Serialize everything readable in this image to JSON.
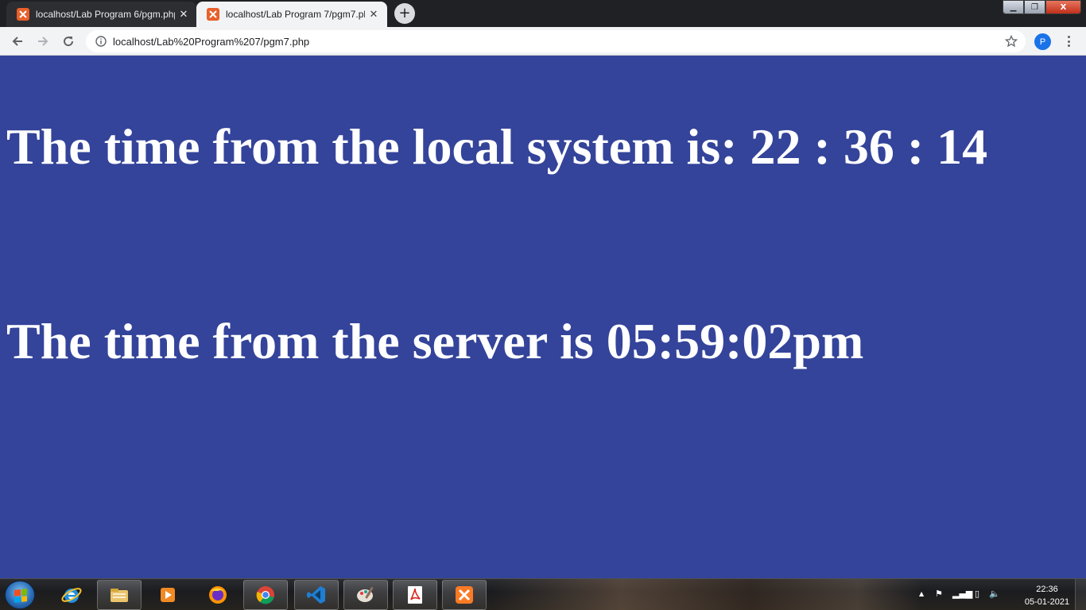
{
  "browser": {
    "tabs": [
      {
        "title": "localhost/Lab Program 6/pgm.php",
        "active": false
      },
      {
        "title": "localhost/Lab Program 7/pgm7.php",
        "active": true
      }
    ],
    "new_tab_label": "+",
    "close_glyph": "✕",
    "address": {
      "url": "localhost/Lab%20Program%207/pgm7.php"
    },
    "profile_initial": "P",
    "window_controls": {
      "minimize": "▁",
      "maximize": "❐",
      "close": "X"
    }
  },
  "page": {
    "local_time_line": "The time from the local system is: 22 : 36 : 14",
    "server_time_line": "The time from the server is 05:59:02pm",
    "background_color": "#34449a",
    "text_color": "#ffffff"
  },
  "taskbar": {
    "pinned": [
      {
        "name": "internet-explorer-icon"
      },
      {
        "name": "file-explorer-icon"
      },
      {
        "name": "media-player-icon"
      },
      {
        "name": "firefox-icon"
      },
      {
        "name": "chrome-icon"
      },
      {
        "name": "vscode-icon"
      },
      {
        "name": "paint-icon"
      },
      {
        "name": "acrobat-reader-icon"
      },
      {
        "name": "xampp-icon"
      }
    ],
    "clock": {
      "time": "22:36",
      "date": "05-01-2021"
    }
  }
}
